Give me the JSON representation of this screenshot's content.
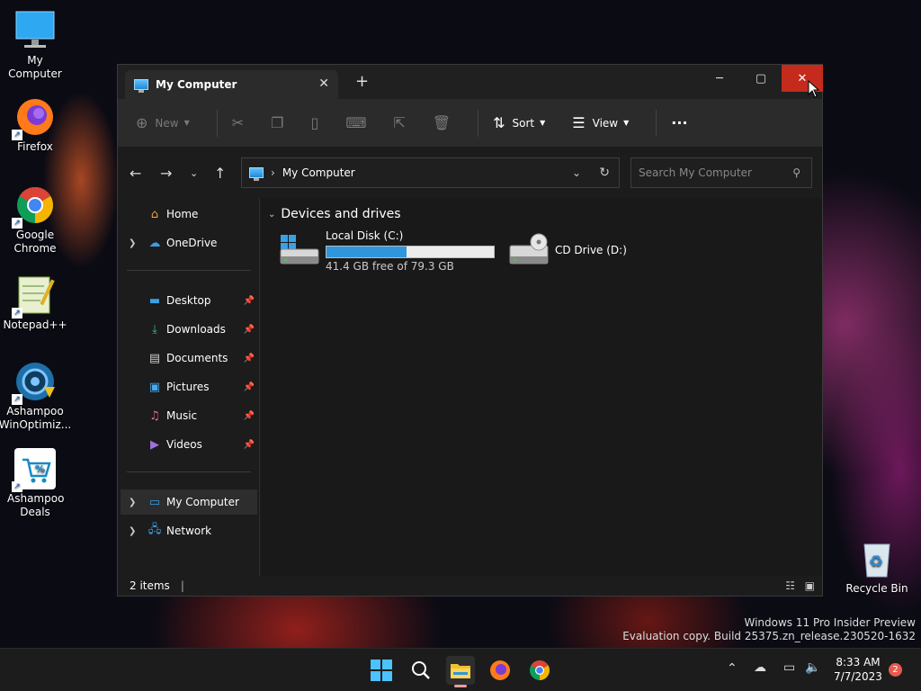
{
  "desktop": {
    "icons": [
      {
        "label": "My Computer"
      },
      {
        "label": "Firefox"
      },
      {
        "label": "Google Chrome"
      },
      {
        "label": "Notepad++"
      },
      {
        "label": "Ashampoo WinOptimiz..."
      },
      {
        "label": "Ashampoo Deals"
      },
      {
        "label": "Recycle Bin"
      }
    ],
    "watermark_line1": "Windows 11 Pro Insider Preview",
    "watermark_line2": "Evaluation copy. Build 25375.zn_release.230520-1632"
  },
  "window": {
    "tab_title": "My Computer",
    "commands": {
      "new": "New",
      "sort": "Sort",
      "view": "View"
    },
    "address": "My Computer",
    "search_placeholder": "Search My Computer",
    "sidebar": {
      "home": "Home",
      "onedrive": "OneDrive",
      "quick": [
        "Desktop",
        "Downloads",
        "Documents",
        "Pictures",
        "Music",
        "Videos"
      ],
      "mycomputer": "My Computer",
      "network": "Network"
    },
    "section_header": "Devices and drives",
    "drives": [
      {
        "name": "Local Disk (C:)",
        "info": "41.4 GB free of 79.3 GB",
        "used_fraction": 0.478
      },
      {
        "name": "CD Drive (D:)"
      }
    ],
    "status_text": "2 items"
  },
  "taskbar": {
    "time": "8:33 AM",
    "date": "7/7/2023",
    "notification_count": "2"
  },
  "colors": {
    "close_button": "#c42b1c",
    "accent": "#3a9ee6",
    "drive_bar": "#2f96dc"
  }
}
